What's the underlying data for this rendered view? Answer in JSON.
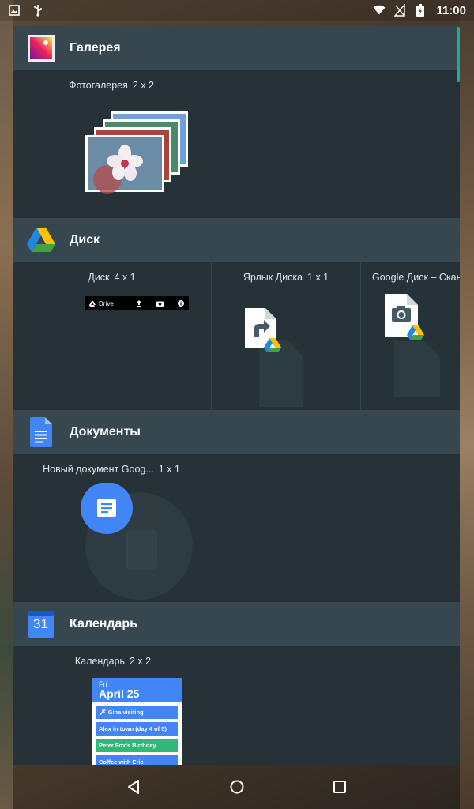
{
  "status_bar": {
    "time": "11:00",
    "left_icons": [
      "image-notification-icon",
      "usb-icon"
    ],
    "right_icons": [
      "wifi-icon",
      "no-sim-icon",
      "battery-charging-icon"
    ]
  },
  "sections": [
    {
      "app_name": "Галерея",
      "icon": "gallery-icon",
      "widgets": [
        {
          "name": "Фотогалерея",
          "dims": "2 x 2"
        }
      ]
    },
    {
      "app_name": "Диск",
      "icon": "google-drive-icon",
      "widgets": [
        {
          "name": "Диск",
          "dims": "4 x 1",
          "bar_label": "Drive"
        },
        {
          "name": "Ярлык Диска",
          "dims": "1 x 1"
        },
        {
          "name": "Google Диск – Скан",
          "dims": ""
        }
      ]
    },
    {
      "app_name": "Документы",
      "icon": "google-docs-icon",
      "widgets": [
        {
          "name": "Новый документ Goog...",
          "dims": "1 x 1"
        }
      ]
    },
    {
      "app_name": "Календарь",
      "icon": "calendar-icon",
      "icon_text": "31",
      "widgets": [
        {
          "name": "Календарь",
          "dims": "2 x 2"
        }
      ]
    }
  ],
  "calendar_preview": {
    "day": "Fri",
    "date": "April 25",
    "events": [
      "Gina visiting",
      "Alex in town (day 4 of 5)",
      "Peter Fox's Birthday",
      "Coffee with Eric"
    ]
  },
  "colors": {
    "panel": "#263238",
    "header": "#37474f",
    "accent": "#26a69a",
    "calendar_blue": "#4285f4",
    "calendar_green": "#33b679"
  }
}
